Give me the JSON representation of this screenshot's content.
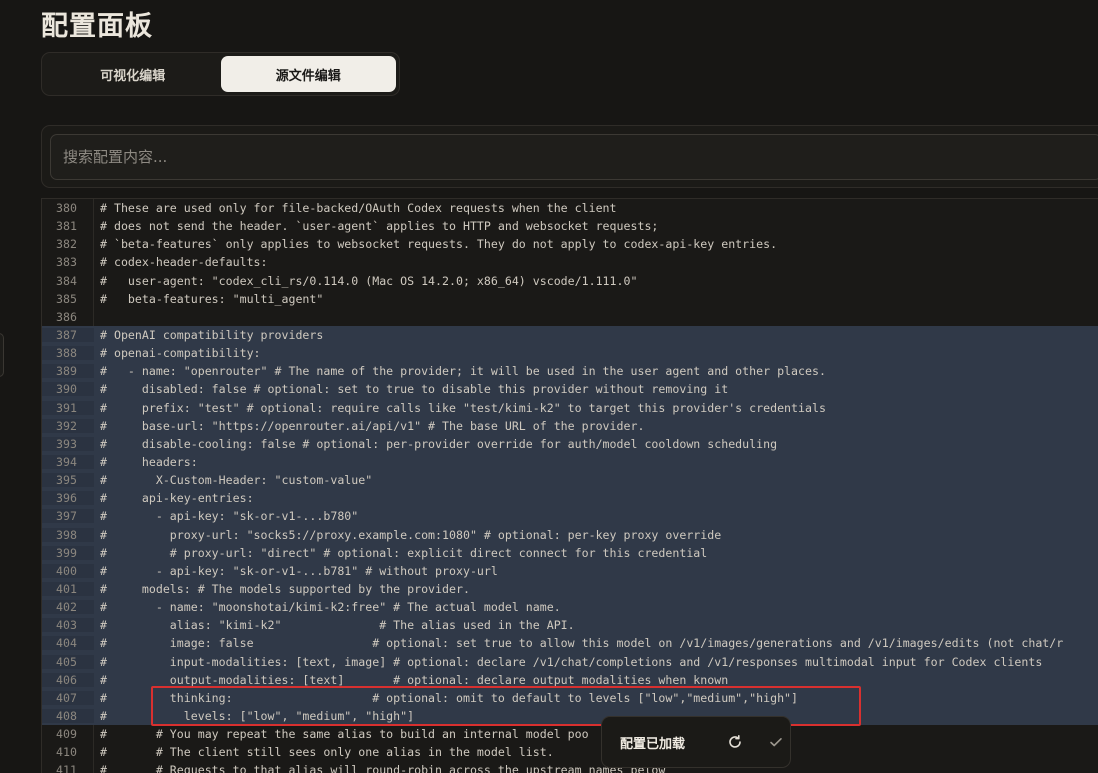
{
  "page": {
    "title": "配置面板"
  },
  "mode_tabs": [
    {
      "label": "可视化编辑",
      "active": false
    },
    {
      "label": "源文件编辑",
      "active": true
    }
  ],
  "search": {
    "placeholder": "搜索配置内容..."
  },
  "editor": {
    "lines": [
      {
        "num": "380",
        "text": "# These are used only for file-backed/OAuth Codex requests when the client",
        "selected": false
      },
      {
        "num": "381",
        "text": "# does not send the header. `user-agent` applies to HTTP and websocket requests;",
        "selected": false
      },
      {
        "num": "382",
        "text": "# `beta-features` only applies to websocket requests. They do not apply to codex-api-key entries.",
        "selected": false
      },
      {
        "num": "383",
        "text": "# codex-header-defaults:",
        "selected": false
      },
      {
        "num": "384",
        "text": "#   user-agent: \"codex_cli_rs/0.114.0 (Mac OS 14.2.0; x86_64) vscode/1.111.0\"",
        "selected": false
      },
      {
        "num": "385",
        "text": "#   beta-features: \"multi_agent\"",
        "selected": false
      },
      {
        "num": "386",
        "text": "",
        "selected": false
      },
      {
        "num": "387",
        "text": "# OpenAI compatibility providers",
        "selected": true
      },
      {
        "num": "388",
        "text": "# openai-compatibility:",
        "selected": true
      },
      {
        "num": "389",
        "text": "#   - name: \"openrouter\" # The name of the provider; it will be used in the user agent and other places.",
        "selected": true
      },
      {
        "num": "390",
        "text": "#     disabled: false # optional: set to true to disable this provider without removing it",
        "selected": true
      },
      {
        "num": "391",
        "text": "#     prefix: \"test\" # optional: require calls like \"test/kimi-k2\" to target this provider's credentials",
        "selected": true
      },
      {
        "num": "392",
        "text": "#     base-url: \"https://openrouter.ai/api/v1\" # The base URL of the provider.",
        "selected": true
      },
      {
        "num": "393",
        "text": "#     disable-cooling: false # optional: per-provider override for auth/model cooldown scheduling",
        "selected": true
      },
      {
        "num": "394",
        "text": "#     headers:",
        "selected": true
      },
      {
        "num": "395",
        "text": "#       X-Custom-Header: \"custom-value\"",
        "selected": true
      },
      {
        "num": "396",
        "text": "#     api-key-entries:",
        "selected": true
      },
      {
        "num": "397",
        "text": "#       - api-key: \"sk-or-v1-...b780\"",
        "selected": true
      },
      {
        "num": "398",
        "text": "#         proxy-url: \"socks5://proxy.example.com:1080\" # optional: per-key proxy override",
        "selected": true
      },
      {
        "num": "399",
        "text": "#         # proxy-url: \"direct\" # optional: explicit direct connect for this credential",
        "selected": true
      },
      {
        "num": "400",
        "text": "#       - api-key: \"sk-or-v1-...b781\" # without proxy-url",
        "selected": true
      },
      {
        "num": "401",
        "text": "#     models: # The models supported by the provider.",
        "selected": true
      },
      {
        "num": "402",
        "text": "#       - name: \"moonshotai/kimi-k2:free\" # The actual model name.",
        "selected": true
      },
      {
        "num": "403",
        "text": "#         alias: \"kimi-k2\"              # The alias used in the API.",
        "selected": true
      },
      {
        "num": "404",
        "text": "#         image: false                 # optional: set true to allow this model on /v1/images/generations and /v1/images/edits (not chat/r",
        "selected": true
      },
      {
        "num": "405",
        "text": "#         input-modalities: [text, image] # optional: declare /v1/chat/completions and /v1/responses multimodal input for Codex clients",
        "selected": true
      },
      {
        "num": "406",
        "text": "#         output-modalities: [text]       # optional: declare output modalities when known",
        "selected": true
      },
      {
        "num": "407",
        "text": "#         thinking:                    # optional: omit to default to levels [\"low\",\"medium\",\"high\"]",
        "selected": true
      },
      {
        "num": "408",
        "text": "#           levels: [\"low\", \"medium\", \"high\"]",
        "selected": true
      },
      {
        "num": "409",
        "text": "#       # You may repeat the same alias to build an internal model poo",
        "selected": false
      },
      {
        "num": "410",
        "text": "#       # The client still sees only one alias in the model list.",
        "selected": false
      },
      {
        "num": "411",
        "text": "#       # Requests to that alias will round-robin across the upstream names below",
        "selected": false
      }
    ]
  },
  "status": {
    "text": "配置已加载",
    "reload_icon": "refresh-icon",
    "confirm_icon": "check-icon"
  },
  "colors": {
    "selection": "#303948",
    "highlight_border": "#d8302f",
    "background": "#171614"
  }
}
